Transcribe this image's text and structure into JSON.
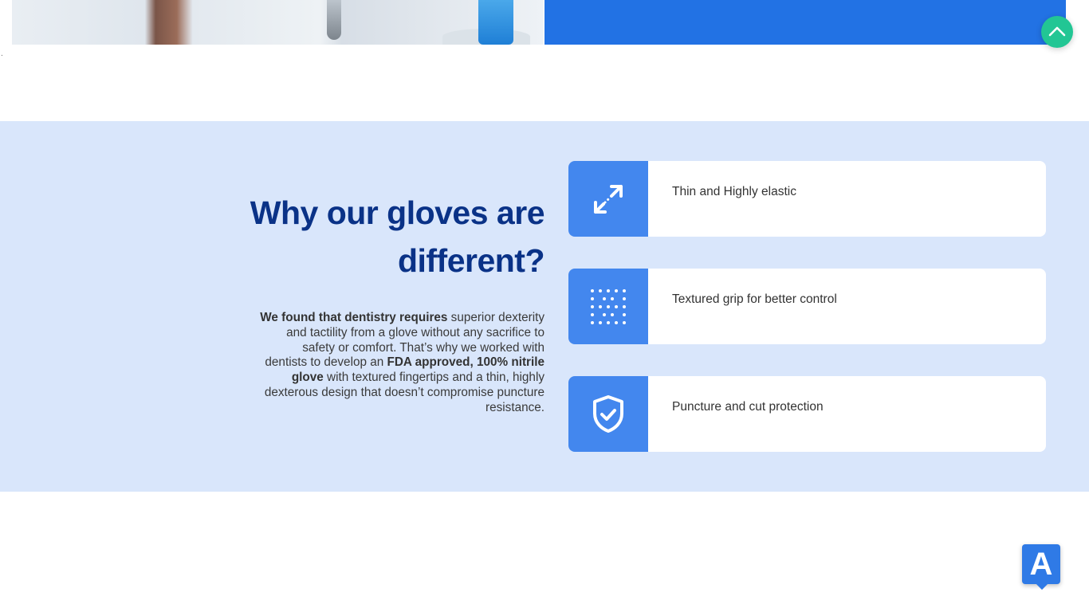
{
  "hero": {
    "photo_alt": "dentist-photo",
    "stray_mark": "."
  },
  "scroll_top": {
    "icon": "chevron-up-icon",
    "color": "#22c694"
  },
  "features": {
    "background": "#d9e6fb",
    "heading": {
      "line1": "Why our gloves are",
      "line2": "different?"
    },
    "description": {
      "b1": "We found that dentistry requires",
      "t1": " superior dexterity and tactility from a glove without any sacrifice to safety or comfort. That’s why we worked with dentists to develop an ",
      "b2": "FDA approved, 100% nitrile glove",
      "t2": " with textured fingertips and a thin, highly dexterous design that doesn’t compromise puncture resistance."
    },
    "cards": [
      {
        "icon": "expand-arrows-icon",
        "label": "Thin and Highly elastic"
      },
      {
        "icon": "dot-grid-icon",
        "label": "Textured grip for better control"
      },
      {
        "icon": "shield-check-icon",
        "label": "Puncture and cut protection"
      }
    ],
    "accent": "#4387ee",
    "heading_color": "#0a3287"
  },
  "widget": {
    "letter": "A",
    "color": "#2f7ae6"
  }
}
